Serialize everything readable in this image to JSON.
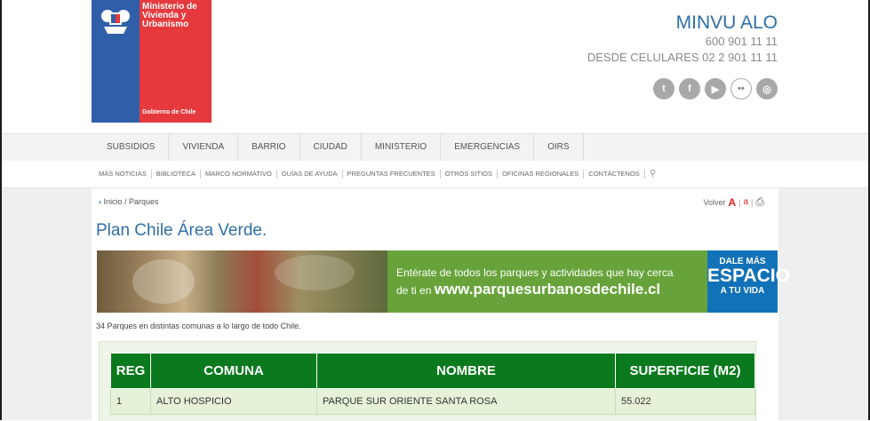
{
  "logo": {
    "ministry_name": "Ministerio de Vivienda y Urbanismo",
    "government": "Gobierno de Chile",
    "brand_colors": {
      "blue": "#2f5fa8",
      "red": "#e5393d"
    }
  },
  "contact": {
    "title": "MINVU ALO",
    "phone": "600 901 11 11",
    "mobile": "DESDE CELULARES 02 2 901 11 11"
  },
  "social": [
    "twitter-icon",
    "facebook-icon",
    "youtube-icon",
    "flickr-icon",
    "instagram-icon"
  ],
  "nav_primary": [
    "SUBSIDIOS",
    "VIVIENDA",
    "BARRIO",
    "CIUDAD",
    "MINISTERIO",
    "EMERGENCIAS",
    "OIRS"
  ],
  "nav_secondary": [
    "MÁS NOTICIAS",
    "BIBLIOTECA",
    "MARCO NORMATIVO",
    "GUÍAS DE AYUDA",
    "PREGUNTAS FRECUENTES",
    "OTROS SITIOS",
    "OFICINAS REGIONALES",
    "CONTÁCTENOS"
  ],
  "breadcrumb": "Inicio / Parques",
  "tools": {
    "back": "Volver",
    "font_large": "A",
    "font_small": "a"
  },
  "page_title": "Plan Chile Área Verde.",
  "banner": {
    "line1": "Entérate de todos los parques y actividades que hay cerca",
    "line2_prefix": "de ti en ",
    "url": "www.parquesurbanosdechile.cl",
    "badge_top": "DALE MÁS",
    "badge_mid": "ESPACIO",
    "badge_bottom": "A TU VIDA"
  },
  "summary": "34 Parques en distintas comunas a lo largo de todo Chile.",
  "table": {
    "headers": [
      "REG",
      "COMUNA",
      "NOMBRE",
      "SUPERFICIE (M2)"
    ],
    "rows": [
      [
        "1",
        "ALTO HOSPICIO",
        "PARQUE SUR ORIENTE SANTA ROSA",
        "55.022"
      ]
    ],
    "header_color": "#0b7a1e"
  }
}
